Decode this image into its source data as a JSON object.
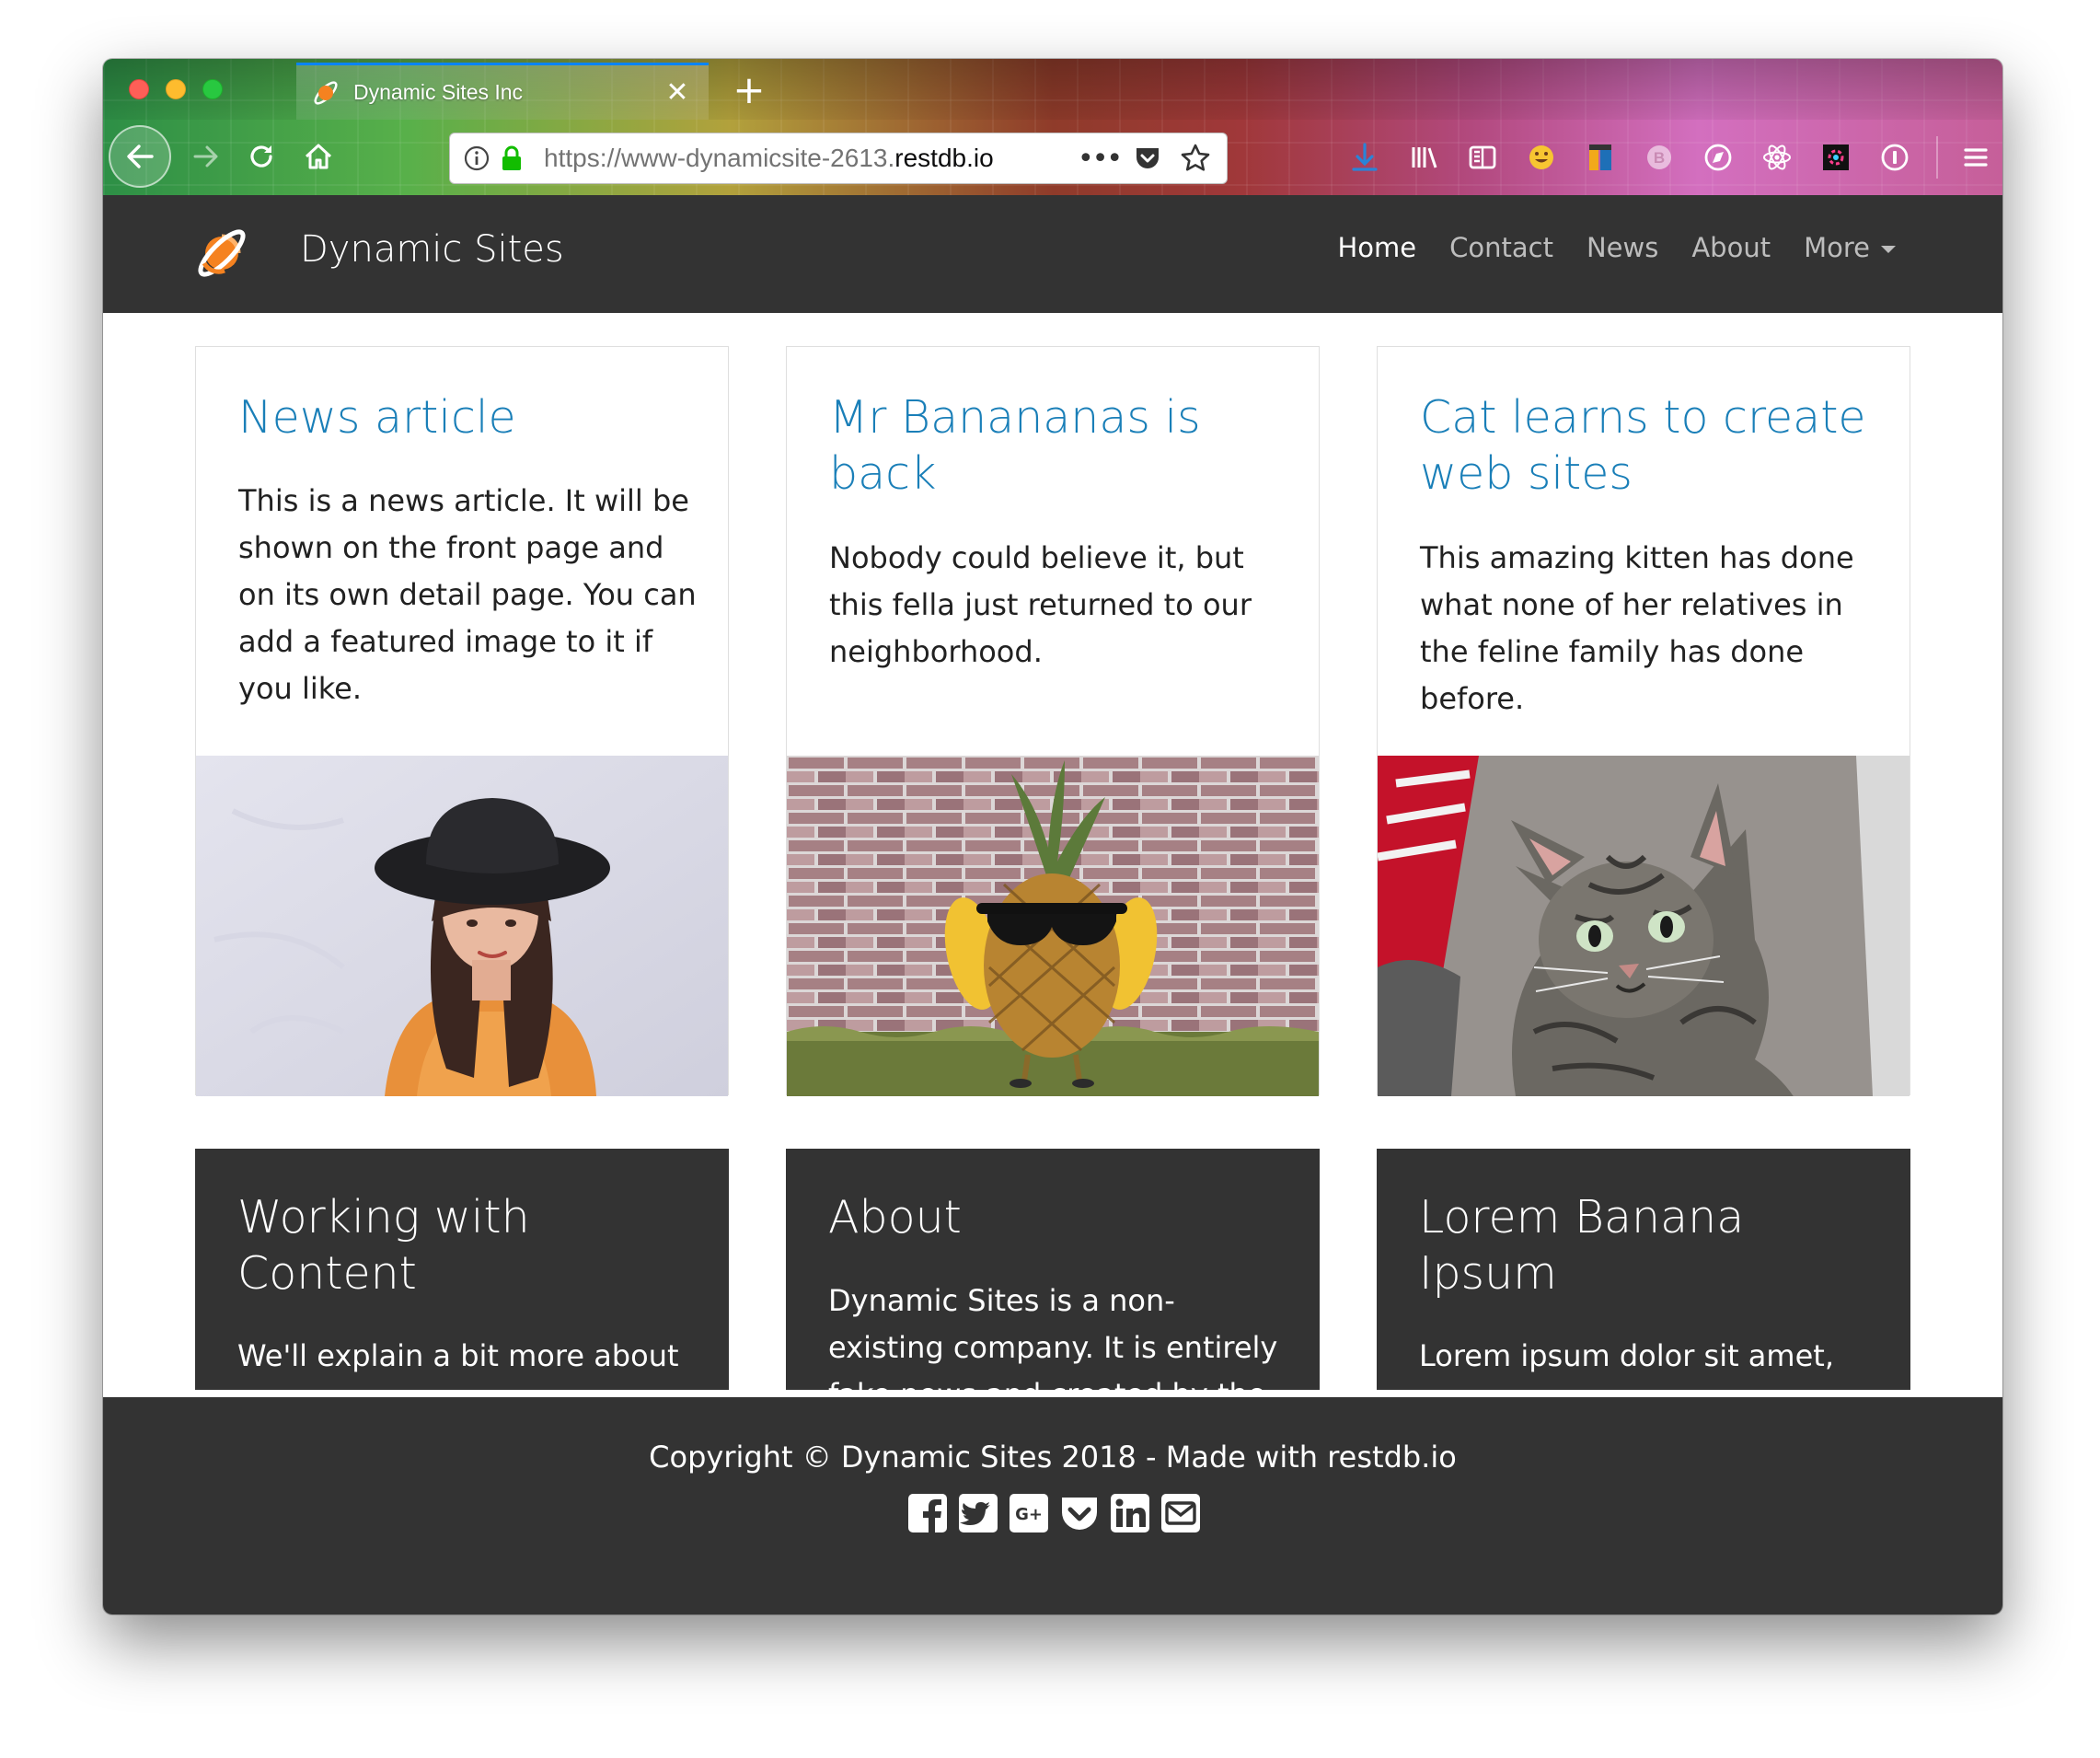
{
  "browser": {
    "tab_title": "Dynamic Sites Inc",
    "tab_close": "✕",
    "new_tab": "+",
    "url_prefix": "https://www-dynamicsite-2613.",
    "url_domain": "restdb.io",
    "url_more": "•••",
    "accent": "#0a84ff",
    "toolbar_icons": [
      "download-icon",
      "library-icon",
      "sidebar-icon",
      "emoji-icon",
      "notes-icon",
      "b-extension-icon",
      "compass-extension-icon",
      "react-icon",
      "color-extension-icon",
      "password-icon"
    ]
  },
  "site": {
    "brand": "Dynamic Sites",
    "brand_color": "#f58220",
    "nav": [
      {
        "label": "Home",
        "active": true
      },
      {
        "label": "Contact",
        "active": false
      },
      {
        "label": "News",
        "active": false
      },
      {
        "label": "About",
        "active": false
      },
      {
        "label": "More",
        "active": false
      }
    ]
  },
  "cards": [
    {
      "title": "News article",
      "text": "This is a news article. It will be shown on the front page and on its own detail page. You can add a featured image to it if you like.",
      "image": "woman-in-black-hat-photo"
    },
    {
      "title": "Mr Banananas is back",
      "text": "Nobody could believe it, but this fella just returned to our neighborhood.",
      "image": "pineapple-with-sunglasses-photo"
    },
    {
      "title": "Cat learns to create web sites",
      "text": "This amazing kitten has done what none of her relatives in the feline family has done before.",
      "image": "tabby-cat-photo"
    }
  ],
  "dark_cards": [
    {
      "title": "Working with Content",
      "text": "We'll explain a bit more about how to add content and how"
    },
    {
      "title": "About",
      "text": "Dynamic Sites is a non-existing company. It is entirely fake news and created by the"
    },
    {
      "title": "Lorem Banana Ipsum",
      "text": "Lorem ipsum dolor sit amet, consectetur adipiscing elit, sed"
    }
  ],
  "footer": {
    "copyright": "Copyright © Dynamic Sites 2018 - Made with restdb.io",
    "social": [
      "facebook-icon",
      "twitter-icon",
      "google-plus-icon",
      "pocket-icon",
      "linkedin-icon",
      "email-icon"
    ],
    "google_plus_label": "G+"
  },
  "colors": {
    "nav_bg": "#333333",
    "link": "#1a7fb8",
    "text": "#212121"
  }
}
